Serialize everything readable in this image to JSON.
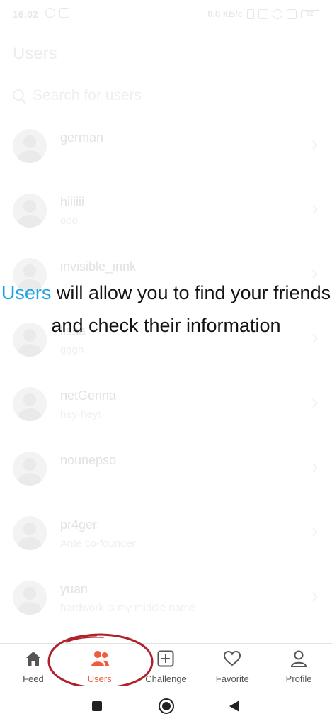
{
  "status_bar": {
    "time": "16:02",
    "network_speed": "0,0 КБ/с",
    "battery": "52"
  },
  "header": {
    "title": "Users"
  },
  "search": {
    "placeholder": "Search for users"
  },
  "users": [
    {
      "name": "german",
      "status": ""
    },
    {
      "name": "hiiiiii",
      "status": "ooo"
    },
    {
      "name": "invisible_innk",
      "status": ""
    },
    {
      "name": "lissa",
      "status": "gggh"
    },
    {
      "name": "netGenna",
      "status": "hey-hey!"
    },
    {
      "name": "nounepso",
      "status": ""
    },
    {
      "name": "pr4ger",
      "status": "Ante co-founder"
    },
    {
      "name": "yuan",
      "status": "hardwork is my middle name"
    }
  ],
  "overlay": {
    "highlight": "Users",
    "text": " will allow you to find your friends and check their information"
  },
  "tabs": [
    {
      "label": "Feed",
      "icon": "home-icon",
      "active": false
    },
    {
      "label": "Users",
      "icon": "users-icon",
      "active": true
    },
    {
      "label": "Challenge",
      "icon": "plus-square-icon",
      "active": false
    },
    {
      "label": "Favorite",
      "icon": "heart-icon",
      "active": false
    },
    {
      "label": "Profile",
      "icon": "person-icon",
      "active": false
    }
  ],
  "colors": {
    "accent": "#f15a3a",
    "highlight": "#1ea3e2",
    "annotation_circle": "#b0202a"
  }
}
